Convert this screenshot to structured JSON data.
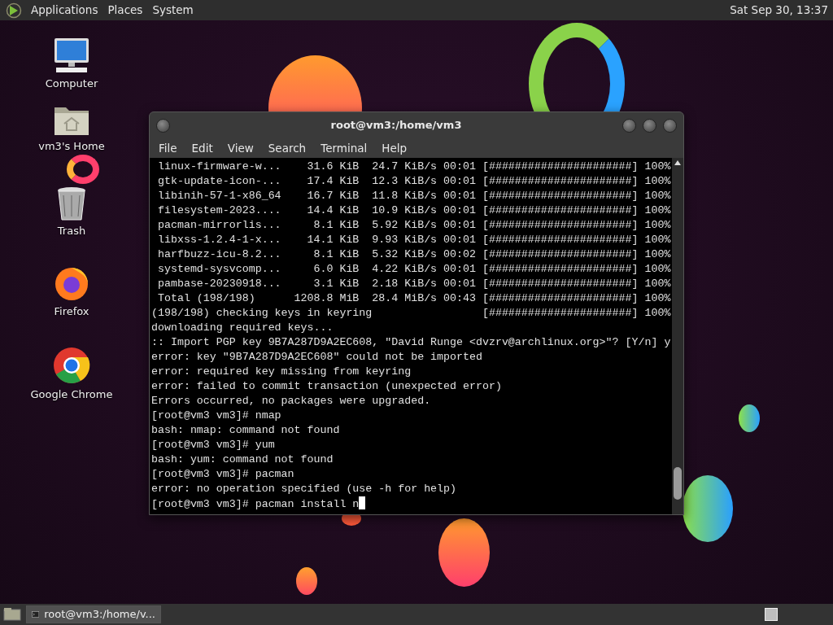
{
  "top_panel": {
    "menus": [
      "Applications",
      "Places",
      "System"
    ],
    "clock": "Sat Sep 30, 13:37"
  },
  "desktop_icons": [
    {
      "label": "Computer",
      "kind": "computer"
    },
    {
      "label": "vm3's Home",
      "kind": "home"
    },
    {
      "label": "Trash",
      "kind": "trash"
    },
    {
      "label": "Firefox",
      "kind": "firefox"
    },
    {
      "label": "Google Chrome",
      "kind": "chrome"
    }
  ],
  "terminal": {
    "title": "root@vm3:/home/vm3",
    "menu": [
      "File",
      "Edit",
      "View",
      "Search",
      "Terminal",
      "Help"
    ],
    "lines": [
      " linux-firmware-w...    31.6 KiB  24.7 KiB/s 00:01 [######################] 100%",
      " gtk-update-icon-...    17.4 KiB  12.3 KiB/s 00:01 [######################] 100%",
      " libinih-57-1-x86_64    16.7 KiB  11.8 KiB/s 00:01 [######################] 100%",
      " filesystem-2023....    14.4 KiB  10.9 KiB/s 00:01 [######################] 100%",
      " pacman-mirrorlis...     8.1 KiB  5.92 KiB/s 00:01 [######################] 100%",
      " libxss-1.2.4-1-x...    14.1 KiB  9.93 KiB/s 00:01 [######################] 100%",
      " harfbuzz-icu-8.2...     8.1 KiB  5.32 KiB/s 00:02 [######################] 100%",
      " systemd-sysvcomp...     6.0 KiB  4.22 KiB/s 00:01 [######################] 100%",
      " pambase-20230918...     3.1 KiB  2.18 KiB/s 00:01 [######################] 100%",
      " Total (198/198)      1208.8 MiB  28.4 MiB/s 00:43 [######################] 100%",
      "(198/198) checking keys in keyring                 [######################] 100%",
      "downloading required keys...",
      ":: Import PGP key 9B7A287D9A2EC608, \"David Runge <dvzrv@archlinux.org>\"? [Y/n] y",
      "error: key \"9B7A287D9A2EC608\" could not be imported",
      "error: required key missing from keyring",
      "error: failed to commit transaction (unexpected error)",
      "Errors occurred, no packages were upgraded.",
      "[root@vm3 vm3]# nmap",
      "bash: nmap: command not found",
      "[root@vm3 vm3]# yum",
      "bash: yum: command not found",
      "[root@vm3 vm3]# pacman",
      "error: no operation specified (use -h for help)",
      "[root@vm3 vm3]# pacman install n"
    ],
    "cursor": true
  },
  "taskbar": {
    "items": [
      {
        "label": "root@vm3:/home/v...",
        "selected": true
      }
    ]
  }
}
